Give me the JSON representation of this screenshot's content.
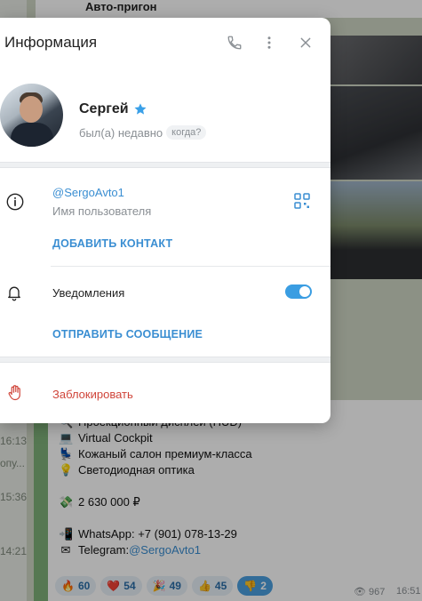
{
  "chat": {
    "title": "Авто-пригон",
    "side_times": [
      "16:13",
      "15:36",
      "14:21"
    ],
    "side_snippet": "опу...",
    "message_lines": [
      {
        "emoji": "🔍",
        "text": "Проекционный дисплей (HUD)"
      },
      {
        "emoji": "💻",
        "text": "Virtual Cockpit"
      },
      {
        "emoji": "💺",
        "text": "Кожаный салон премиум-класса"
      },
      {
        "emoji": "💡",
        "text": "Светодиодная оптика"
      },
      {
        "emoji": "",
        "text": ""
      },
      {
        "emoji": "💸",
        "text": "2 630 000 ₽"
      },
      {
        "emoji": "",
        "text": ""
      },
      {
        "emoji": "📲",
        "text": "WhatsApp: +7 (901) 078-13-29"
      }
    ],
    "telegram_prefix": "Telegram: ",
    "telegram_link": "@SergoAvto1",
    "reactions": [
      {
        "emoji": "🔥",
        "count": "60"
      },
      {
        "emoji": "❤️",
        "count": "54"
      },
      {
        "emoji": "🎉",
        "count": "49"
      },
      {
        "emoji": "👍",
        "count": "45"
      },
      {
        "emoji": "👎",
        "count": "2"
      }
    ],
    "views": "967",
    "time": "16:51"
  },
  "panel": {
    "title": "Информация",
    "profile": {
      "name": "Сергей",
      "status": "был(а) недавно",
      "when_chip": "когда?"
    },
    "username": "@SergoAvto1",
    "username_label": "Имя пользователя",
    "add_contact": "ДОБАВИТЬ КОНТАКТ",
    "notifications_label": "Уведомления",
    "notifications_on": true,
    "send_message": "ОТПРАВИТЬ СООБЩЕНИЕ",
    "block": "Заблокировать"
  },
  "colors": {
    "accent": "#3a8ed2",
    "toggle": "#3a9de2",
    "danger": "#d0453a"
  }
}
